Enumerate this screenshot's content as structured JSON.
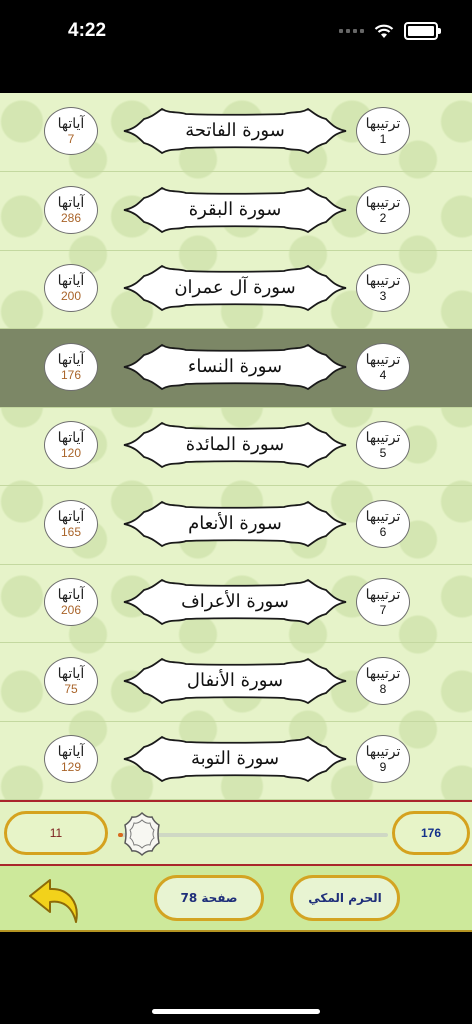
{
  "status": {
    "time": "4:22"
  },
  "labels": {
    "ayat_word": "آياتها",
    "order_word": "ترتيبها"
  },
  "colors": {
    "selected_row": "#7c8766",
    "background": "#e6f3c9",
    "pill_border": "#d5a21e",
    "accent_red": "#a9262b"
  },
  "surahs": [
    {
      "order": "1",
      "name": "سورة الفاتحة",
      "ayat": "7"
    },
    {
      "order": "2",
      "name": "سورة البقرة",
      "ayat": "286"
    },
    {
      "order": "3",
      "name": "سورة آل عمران",
      "ayat": "200"
    },
    {
      "order": "4",
      "name": "سورة النساء",
      "ayat": "176",
      "selected": true
    },
    {
      "order": "5",
      "name": "سورة المائدة",
      "ayat": "120"
    },
    {
      "order": "6",
      "name": "سورة الأنعام",
      "ayat": "165"
    },
    {
      "order": "7",
      "name": "سورة الأعراف",
      "ayat": "206"
    },
    {
      "order": "8",
      "name": "سورة الأنفال",
      "ayat": "75"
    },
    {
      "order": "9",
      "name": "سورة التوبة",
      "ayat": "129"
    }
  ],
  "slider": {
    "min_label": "11",
    "max_label": "176",
    "progress": 0.02
  },
  "toolbar": {
    "page_label": "صفحة 78",
    "mecca_label": "الحرم المكي",
    "back_icon": "back-arrow-icon"
  }
}
